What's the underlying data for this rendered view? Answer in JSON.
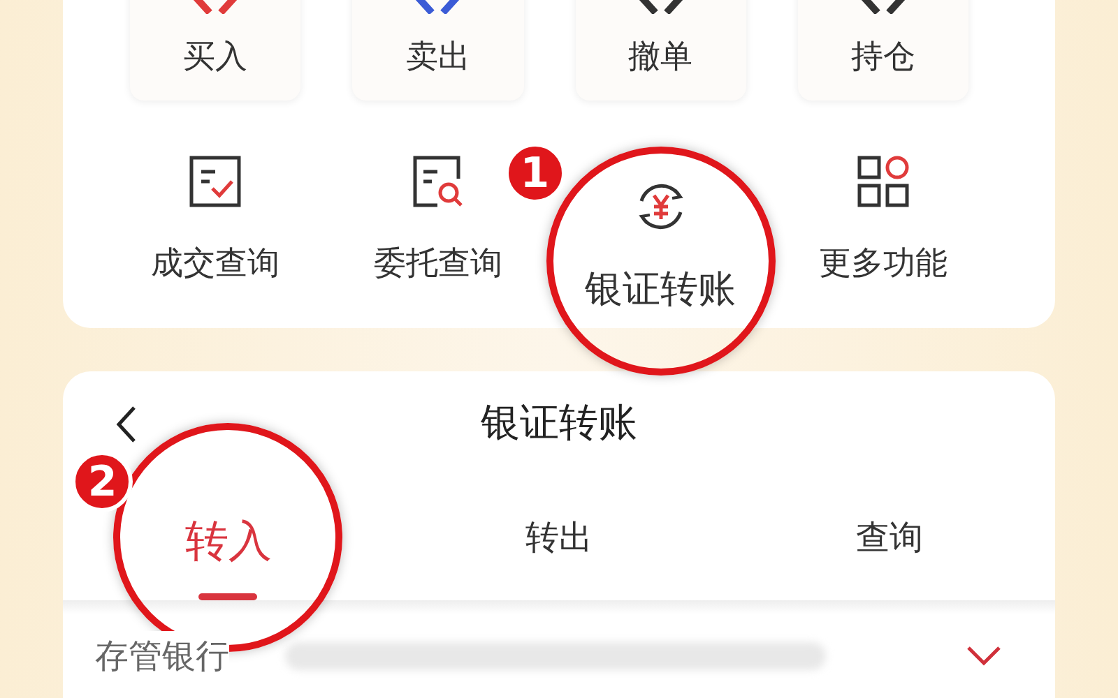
{
  "trade_buttons": [
    {
      "label": "买入",
      "color": "#e03b3b"
    },
    {
      "label": "卖出",
      "color": "#3b5bd6"
    },
    {
      "label": "撤单",
      "color": "#333333"
    },
    {
      "label": "持仓",
      "color": "#333333"
    }
  ],
  "tools": [
    {
      "label": "成交查询",
      "kind": "check"
    },
    {
      "label": "委托查询",
      "kind": "search"
    },
    {
      "label": "银证转账",
      "kind": "transfer",
      "callout": "1"
    },
    {
      "label": "更多功能",
      "kind": "grid"
    }
  ],
  "transfer_panel": {
    "title": "银证转账",
    "tabs": [
      {
        "label": "转入",
        "selected": true,
        "callout": "2"
      },
      {
        "label": "转出",
        "selected": false
      },
      {
        "label": "查询",
        "selected": false
      }
    ],
    "field": {
      "label": "存管银行"
    }
  }
}
